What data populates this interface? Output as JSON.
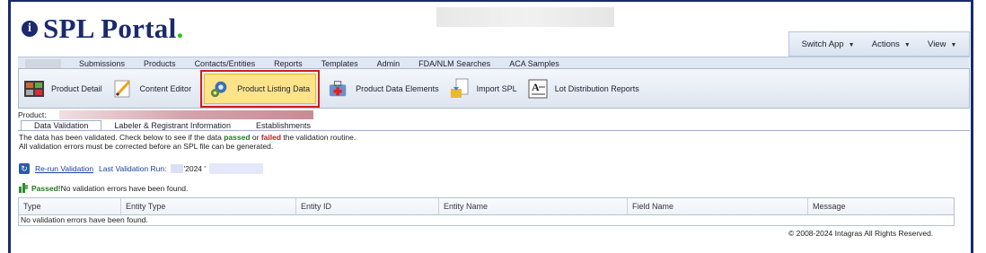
{
  "app": {
    "title": "SPL Portal",
    "title_dot": "."
  },
  "header_menu": [
    {
      "label": "Switch App"
    },
    {
      "label": "Actions"
    },
    {
      "label": "View"
    }
  ],
  "nav_tabs": [
    "Submissions",
    "Products",
    "Contacts/Entities",
    "Reports",
    "Templates",
    "Admin",
    "FDA/NLM Searches",
    "ACA Samples"
  ],
  "toolbar": [
    {
      "label": "Product Detail",
      "icon": "product-detail-icon",
      "active": false
    },
    {
      "label": "Content Editor",
      "icon": "pencil-icon",
      "active": false
    },
    {
      "label": "Product Listing Data",
      "icon": "gear-icon",
      "active": true
    },
    {
      "label": "Product Data Elements",
      "icon": "medkit-icon",
      "active": false
    },
    {
      "label": "Import SPL",
      "icon": "import-icon",
      "active": false
    },
    {
      "label": "Lot Distribution Reports",
      "icon": "document-a-icon",
      "active": false
    }
  ],
  "product": {
    "label": "Product:"
  },
  "sub_tabs": [
    {
      "label": "Data Validation",
      "selected": true
    },
    {
      "label": "Labeler & Registrant Information",
      "selected": false
    },
    {
      "label": "Establishments",
      "selected": false
    }
  ],
  "validation_note": {
    "line1_a": "The data has been validated. Check below to see if the data ",
    "passed": "passed",
    "line1_b": " or ",
    "failed": "failed",
    "line1_c": " the validation routine.",
    "line2": "All validation errors must be corrected before an SPL file can be generated."
  },
  "rerun": {
    "link": "Re-run Validation",
    "last_run_label": "Last Validation Run:",
    "last_run_partial": "'2024 '"
  },
  "status": {
    "passed_label": "Passed!",
    "message": " No validation errors have been found."
  },
  "grid": {
    "columns": [
      "Type",
      "Entity Type",
      "Entity ID",
      "Entity Name",
      "Field Name",
      "Message"
    ],
    "empty_message": "No validation errors have been found."
  },
  "footer": {
    "copyright": "© 2008-2024 Intagras All Rights Reserved."
  },
  "colors": {
    "brand": "#1a2a6c",
    "accent_green": "#2ec41a",
    "active_tab_bg": "#fde48a",
    "highlight_outline": "#d21e1e"
  }
}
